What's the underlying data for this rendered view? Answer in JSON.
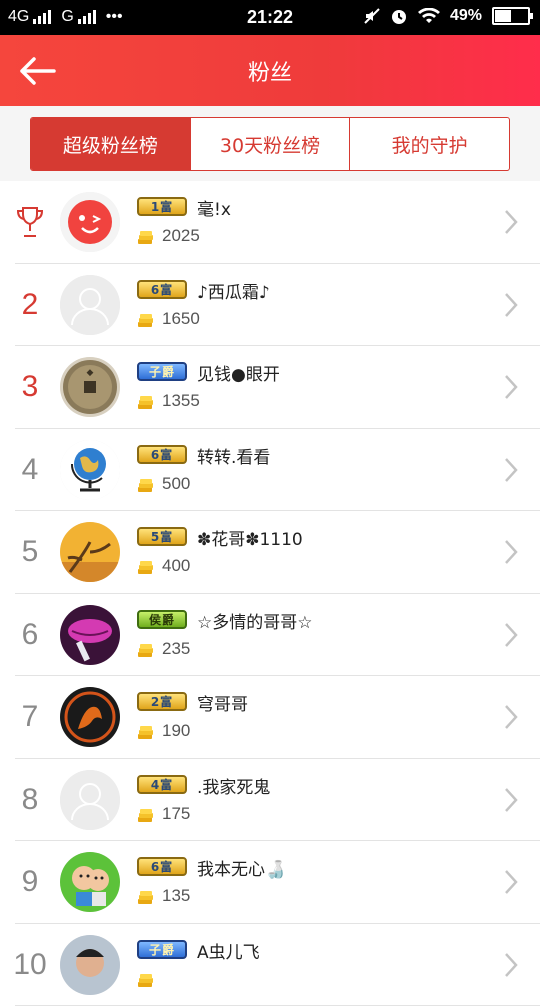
{
  "status_bar": {
    "network_1": "4G",
    "network_2": "G",
    "dots": "•••",
    "time": "21:22",
    "battery_percent": "49%",
    "battery_level": 0.49
  },
  "header": {
    "title": "粉丝",
    "back_icon": "arrow-left-icon"
  },
  "tabs": [
    {
      "label": "超级粉丝榜",
      "active": true
    },
    {
      "label": "30天粉丝榜",
      "active": false
    },
    {
      "label": "我的守护",
      "active": false
    }
  ],
  "colors": {
    "accent": "#d63a32",
    "header_start": "#f5463d",
    "header_end": "#ff2d4b"
  },
  "fans": [
    {
      "rank": "1",
      "badge": "1富",
      "badge_style": "gold",
      "name": "毫!x",
      "score": "2025",
      "avatar": "red-face"
    },
    {
      "rank": "2",
      "badge": "6富",
      "badge_style": "gold",
      "name": "♪西瓜霜♪",
      "score": "1650",
      "avatar": "default"
    },
    {
      "rank": "3",
      "badge": "子爵",
      "badge_style": "blue",
      "name": "见钱●眼开",
      "score": "1355",
      "avatar": "coin"
    },
    {
      "rank": "4",
      "badge": "6富",
      "badge_style": "gold",
      "name": "转转.看看",
      "score": "500",
      "avatar": "globe"
    },
    {
      "rank": "5",
      "badge": "5富",
      "badge_style": "gold",
      "name": "✽花哥✽1110",
      "score": "400",
      "avatar": "tree"
    },
    {
      "rank": "6",
      "badge": "侯爵",
      "badge_style": "green",
      "name": "☆多情的哥哥☆",
      "score": "235",
      "avatar": "lips"
    },
    {
      "rank": "7",
      "badge": "2富",
      "badge_style": "gold",
      "name": "穹哥哥",
      "score": "190",
      "avatar": "dragon"
    },
    {
      "rank": "8",
      "badge": "4富",
      "badge_style": "gold",
      "name": ".我家死鬼",
      "score": "175",
      "avatar": "default"
    },
    {
      "rank": "9",
      "badge": "6富",
      "badge_style": "gold",
      "name": "我本无心🍶",
      "score": "135",
      "avatar": "cartoon"
    },
    {
      "rank": "10",
      "badge": "子爵",
      "badge_style": "blue",
      "name": "A虫儿飞",
      "score": "",
      "avatar": "person"
    }
  ]
}
